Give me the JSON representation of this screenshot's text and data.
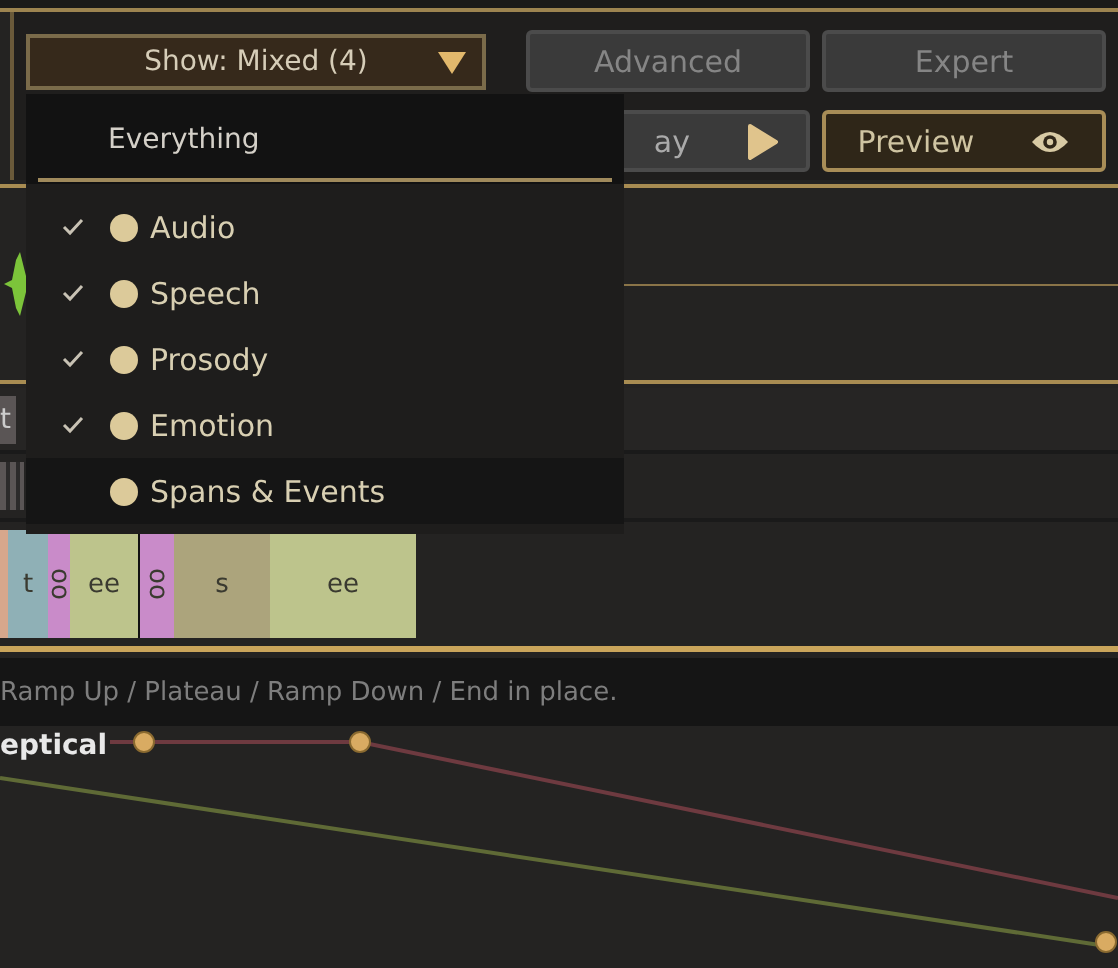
{
  "toolbar": {
    "show_dropdown": {
      "label": "Show: Mixed (4)",
      "expanded": true
    },
    "buttons": [
      {
        "label": "Advanced",
        "kind": "plain"
      },
      {
        "label": "Expert",
        "kind": "plain"
      },
      {
        "label": "ay",
        "kind": "play"
      },
      {
        "label": "Preview",
        "kind": "preview"
      }
    ]
  },
  "show_menu": {
    "header": "Everything",
    "items": [
      {
        "label": "Audio",
        "checked": true,
        "hovered": false
      },
      {
        "label": "Speech",
        "checked": true,
        "hovered": false
      },
      {
        "label": "Prosody",
        "checked": true,
        "hovered": false
      },
      {
        "label": "Emotion",
        "checked": true,
        "hovered": false
      },
      {
        "label": "Spans & Events",
        "checked": false,
        "hovered": true
      }
    ]
  },
  "side_button": "t",
  "phonemes": [
    {
      "color": "#d6a78c",
      "kind": "horizontal"
    },
    {
      "label": "t",
      "color": "#8fb0b6",
      "kind": "horizontal"
    },
    {
      "label": "oo",
      "color": "#c98bc9",
      "kind": "vertical"
    },
    {
      "label": "ee",
      "color": "#bdc48c",
      "kind": "horizontal"
    },
    {
      "label": "oo",
      "color": "#c98bc9",
      "kind": "vertical"
    },
    {
      "label": "s",
      "color": "#aca47c",
      "kind": "horizontal"
    },
    {
      "label": "ee",
      "color": "#bdc48c",
      "kind": "horizontal"
    }
  ],
  "hint": "Ramp Up / Plateau / Ramp Down / End in place.",
  "curve_label": "eptical"
}
